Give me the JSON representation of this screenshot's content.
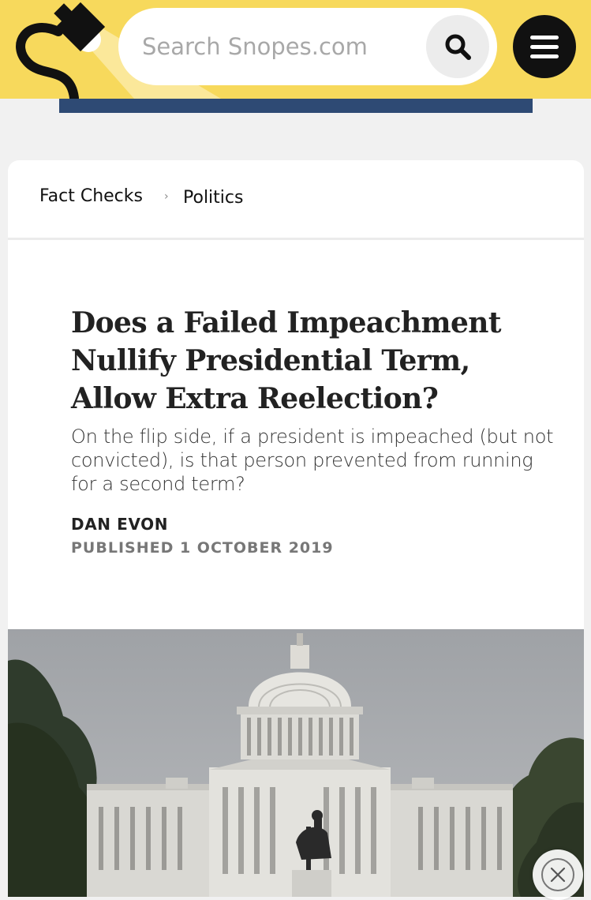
{
  "header": {
    "search_placeholder": "Search Snopes.com",
    "search_icon": "search-icon",
    "menu_icon": "hamburger-menu-icon",
    "logo_icon": "snopes-lamp-logo",
    "colors": {
      "header_bg": "#f7d95c",
      "strip": "#2e4a74",
      "menu_button": "#111111"
    }
  },
  "breadcrumb": {
    "items": [
      "Fact Checks",
      "Politics"
    ],
    "separator": "›"
  },
  "article": {
    "title": "Does a Failed Impeachment Nullify Presidential Term, Allow Extra Reelection?",
    "subtitle": "On the flip side, if a president is impeached (but not convicted), is that person prevented from running for a second term?",
    "author": "DAN EVON",
    "published": "PUBLISHED 1 OCTOBER 2019"
  },
  "hero_image": {
    "subject": "U.S. Capitol building with an equestrian statue under an overcast sky"
  },
  "overlay": {
    "close_icon": "close-icon"
  }
}
